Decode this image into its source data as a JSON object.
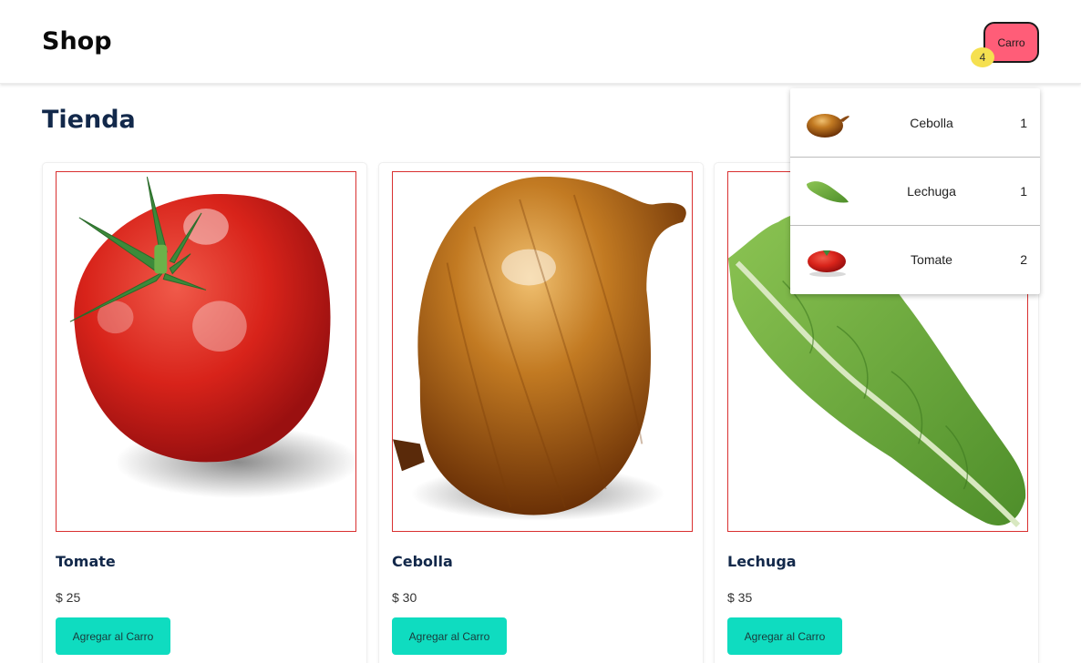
{
  "header": {
    "logo": "Shop",
    "cart_label": "Carro",
    "cart_count": "4"
  },
  "main": {
    "title": "Tienda",
    "products": [
      {
        "name": "Tomate",
        "price": "$ 25",
        "button": "Agregar al Carro",
        "icon": "tomato-image"
      },
      {
        "name": "Cebolla",
        "price": "$ 30",
        "button": "Agregar al Carro",
        "icon": "onion-image"
      },
      {
        "name": "Lechuga",
        "price": "$ 35",
        "button": "Agregar al Carro",
        "icon": "lettuce-image"
      }
    ]
  },
  "cart_dropdown": {
    "items": [
      {
        "name": "Cebolla",
        "qty": "1",
        "icon": "onion-thumbnail"
      },
      {
        "name": "Lechuga",
        "qty": "1",
        "icon": "lettuce-thumbnail"
      },
      {
        "name": "Tomate",
        "qty": "2",
        "icon": "tomato-thumbnail"
      }
    ]
  },
  "colors": {
    "cart_button": "#ff5d78",
    "cart_badge": "#f5e050",
    "add_button": "#0fdcc0",
    "heading": "#12284a",
    "image_border": "#d93030"
  }
}
